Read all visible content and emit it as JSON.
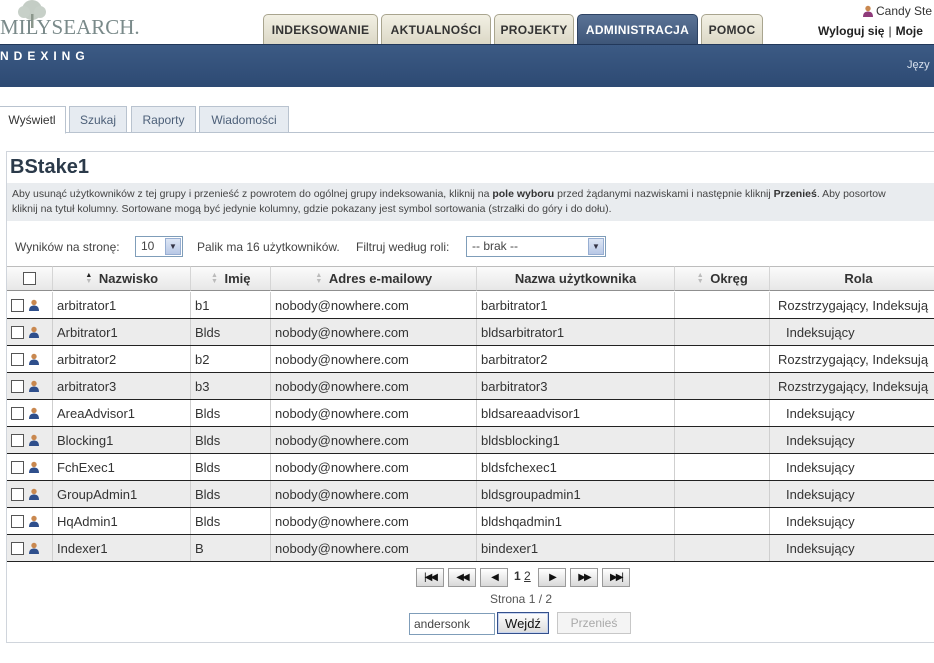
{
  "header": {
    "logo_text": "MILYSEARCH.",
    "user_name": "Candy Ste",
    "logout": "Wyloguj się",
    "my_link": "Moje",
    "tabs": [
      {
        "label": "INDEKSOWANIE"
      },
      {
        "label": "AKTUALNOŚCI"
      },
      {
        "label": "PROJEKTY"
      },
      {
        "label": "ADMINISTRACJA"
      },
      {
        "label": "POMOC"
      }
    ]
  },
  "banner": {
    "section": "NDEXING",
    "language": "Języ"
  },
  "subtabs": [
    {
      "label": "Wyświetl"
    },
    {
      "label": "Szukaj"
    },
    {
      "label": "Raporty"
    },
    {
      "label": "Wiadomości"
    }
  ],
  "page": {
    "title": "BStake1",
    "info_line1_a": "Aby usunąć użytkowników z tej grupy i przenieść z powrotem do ogólnej grupy indeksowania, kliknij na ",
    "info_line1_b": "pole wyboru",
    "info_line1_c": " przed żądanymi nazwiskami i następnie kliknij ",
    "info_line1_d": "Przenieś",
    "info_line1_e": ". Aby posortow",
    "info_line2": "kliknij na tytuł kolumny. Sortowane mogą być jedynie kolumny, gdzie pokazany jest symbol sortowania (strzałki do góry i do dołu)."
  },
  "controls": {
    "perpage_label": "Wyników na stronę:",
    "perpage_value": "10",
    "pack_text": "Palik ma 16 użytkowników.",
    "role_label": "Filtruj według roli:",
    "role_value": "-- brak --"
  },
  "table": {
    "headers": {
      "surname": "Nazwisko",
      "first": "Imię",
      "email": "Adres e-mailowy",
      "username": "Nazwa użytkownika",
      "district": "Okręg",
      "role": "Rola"
    },
    "rows": [
      {
        "surname": "arbitrator1",
        "first": "b1",
        "email": "nobody@nowhere.com",
        "username": "barbitrator1",
        "district": "",
        "role": "Rozstrzygający,  Indeksują"
      },
      {
        "surname": "Arbitrator1",
        "first": "Blds",
        "email": "nobody@nowhere.com",
        "username": "bldsarbitrator1",
        "district": "",
        "role": "Indeksujący"
      },
      {
        "surname": "arbitrator2",
        "first": "b2",
        "email": "nobody@nowhere.com",
        "username": "barbitrator2",
        "district": "",
        "role": "Rozstrzygający,  Indeksują"
      },
      {
        "surname": "arbitrator3",
        "first": "b3",
        "email": "nobody@nowhere.com",
        "username": "barbitrator3",
        "district": "",
        "role": "Rozstrzygający,  Indeksują"
      },
      {
        "surname": "AreaAdvisor1",
        "first": "Blds",
        "email": "nobody@nowhere.com",
        "username": "bldsareaadvisor1",
        "district": "",
        "role": "Indeksujący"
      },
      {
        "surname": "Blocking1",
        "first": "Blds",
        "email": "nobody@nowhere.com",
        "username": "bldsblocking1",
        "district": "",
        "role": "Indeksujący"
      },
      {
        "surname": "FchExec1",
        "first": "Blds",
        "email": "nobody@nowhere.com",
        "username": "bldsfchexec1",
        "district": "",
        "role": "Indeksujący"
      },
      {
        "surname": "GroupAdmin1",
        "first": "Blds",
        "email": "nobody@nowhere.com",
        "username": "bldsgroupadmin1",
        "district": "",
        "role": "Indeksujący"
      },
      {
        "surname": "HqAdmin1",
        "first": "Blds",
        "email": "nobody@nowhere.com",
        "username": "bldshqadmin1",
        "district": "",
        "role": "Indeksujący"
      },
      {
        "surname": "Indexer1",
        "first": "B",
        "email": "nobody@nowhere.com",
        "username": "bindexer1",
        "district": "",
        "role": "Indeksujący"
      }
    ]
  },
  "pager": {
    "page1": "1",
    "page2": "2",
    "page_of": "Strona 1 / 2"
  },
  "actions": {
    "search_value": "andersonk",
    "go_label": "Wejdź",
    "move_label": "Przenieś"
  },
  "colors": {
    "banner": "#2d4a73",
    "active_tab": "#4a6386"
  }
}
